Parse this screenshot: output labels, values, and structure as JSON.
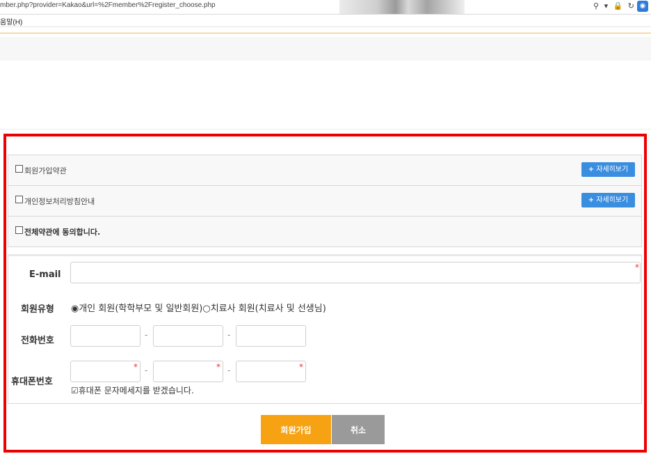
{
  "browser": {
    "url": "mber.php?provider=Kakao&url=%2Fmember%2Fregister_choose.php",
    "menu_label": "움말(H)",
    "icons": "⚲ ▾ 🔒 ↻"
  },
  "terms": {
    "items": [
      {
        "label": "회원가입약관",
        "button": "자세히보기"
      },
      {
        "label": "개인정보처리방침안내",
        "button": "자세히보기"
      }
    ],
    "agree_all": "전체약관에 동의합니다."
  },
  "form": {
    "email_label": "E-mail",
    "email_value": "",
    "member_type_label": "회원유형",
    "member_type_options": [
      {
        "label": "개인 회원(학학부모 및 일반회원)",
        "selected": true
      },
      {
        "label": "치료사 회원(치료사 및 선생님)",
        "selected": false
      }
    ],
    "phone_label": "전화번호",
    "mobile_label": "휴대폰번호",
    "dash": "-",
    "required_mark": "*",
    "sms_label": "휴대폰 문자메세지를 받겠습니다.",
    "sms_checked": true
  },
  "actions": {
    "join": "회원가입",
    "cancel": "취소"
  },
  "colors": {
    "highlight": "#ee0000",
    "join_button": "#f7a213",
    "cancel_button": "#9a9a9a",
    "detail_button": "#3a8ee0"
  }
}
